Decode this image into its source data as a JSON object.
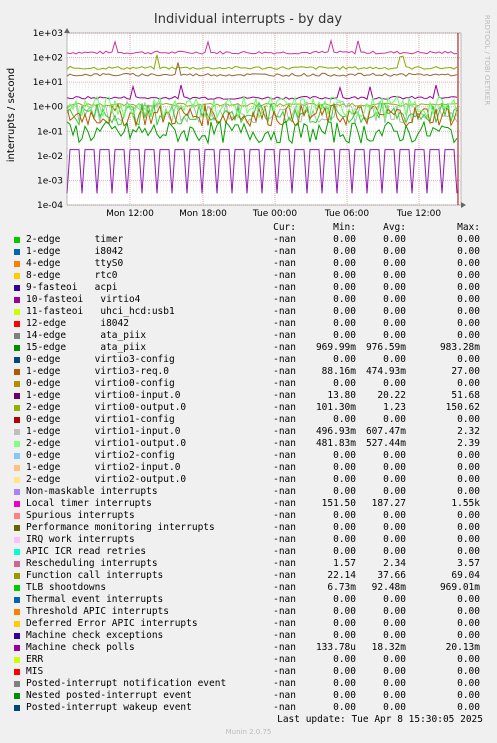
{
  "title": "Individual interrupts - by day",
  "ylabel": "interrupts / second",
  "side_label": "RRDTOOL / TOBI OETIKER",
  "columns": {
    "cur": "Cur:",
    "min": "Min:",
    "avg": "Avg:",
    "max": "Max:"
  },
  "colors": {
    "background": "#f0f0f0",
    "plot_bg": "#ffffff",
    "grid_major": "#e0b0b0",
    "grid_minor": "#ededed",
    "frame": "#808080",
    "now_marker": "#aa0000"
  },
  "chart_data": {
    "type": "line",
    "yscale": "log",
    "ylim": [
      0.0001,
      1000
    ],
    "yticks": [
      "1e-04",
      "1e-03",
      "1e-02",
      "1e-01",
      "1e+00",
      "1e+01",
      "1e+02",
      "1e+03"
    ],
    "xticks": [
      "Mon 12:00",
      "Mon 18:00",
      "Tue 00:00",
      "Tue 06:00",
      "Tue 12:00"
    ],
    "series": [
      {
        "name": "Local timer interrupts",
        "color": "#CC3399",
        "level": 160
      },
      {
        "name": "Rescheduling interrupts",
        "color": "#990099",
        "level": 2.3
      },
      {
        "name": "Function call interrupts",
        "color": "#88AA00",
        "level": 38
      },
      {
        "name": "virtio0-output.0",
        "color": "#8FAF1F",
        "level": 1.2
      },
      {
        "name": "virtio1-input.0",
        "color": "#A3C2A3",
        "level": 0.6
      },
      {
        "name": "virtio1-output.0",
        "color": "#33CC33",
        "level": 0.5
      },
      {
        "name": "virtio3-req.0",
        "color": "#B35A00",
        "level": 0.45
      },
      {
        "name": "ata_piix",
        "color": "#66FF66",
        "level": 0.97
      },
      {
        "name": "virtio0-input.0",
        "color": "#996633",
        "level": 20
      },
      {
        "name": "TLB shootdowns",
        "color": "#00A000",
        "level": 0.09
      },
      {
        "name": "Machine check polls",
        "color": "#8C1AB3",
        "level": 0.018
      }
    ]
  },
  "legend": [
    {
      "name": "2-edge      timer",
      "color": "#00CC00",
      "cur": "-nan",
      "min": "0.00",
      "avg": "0.00",
      "max": "0.00"
    },
    {
      "name": "1-edge      i8042",
      "color": "#0066B3",
      "cur": "-nan",
      "min": "0.00",
      "avg": "0.00",
      "max": "0.00"
    },
    {
      "name": "4-edge      ttyS0",
      "color": "#FF8000",
      "cur": "-nan",
      "min": "0.00",
      "avg": "0.00",
      "max": "0.00"
    },
    {
      "name": "8-edge      rtc0",
      "color": "#FFCC00",
      "cur": "-nan",
      "min": "0.00",
      "avg": "0.00",
      "max": "0.00"
    },
    {
      "name": "9-fasteoi   acpi",
      "color": "#330099",
      "cur": "-nan",
      "min": "0.00",
      "avg": "0.00",
      "max": "0.00"
    },
    {
      "name": "10-fasteoi   virtio4",
      "color": "#990099",
      "cur": "-nan",
      "min": "0.00",
      "avg": "0.00",
      "max": "0.00"
    },
    {
      "name": "11-fasteoi   uhci_hcd:usb1",
      "color": "#CCFF00",
      "cur": "-nan",
      "min": "0.00",
      "avg": "0.00",
      "max": "0.00"
    },
    {
      "name": "12-edge      i8042",
      "color": "#FF0000",
      "cur": "-nan",
      "min": "0.00",
      "avg": "0.00",
      "max": "0.00"
    },
    {
      "name": "14-edge      ata_piix",
      "color": "#808080",
      "cur": "-nan",
      "min": "0.00",
      "avg": "0.00",
      "max": "0.00"
    },
    {
      "name": "15-edge      ata_piix",
      "color": "#008F00",
      "cur": "-nan",
      "min": "969.99m",
      "avg": "976.59m",
      "max": "983.28m"
    },
    {
      "name": "0-edge      virtio3-config",
      "color": "#00487D",
      "cur": "-nan",
      "min": "0.00",
      "avg": "0.00",
      "max": "0.00"
    },
    {
      "name": "1-edge      virtio3-req.0",
      "color": "#B35A00",
      "cur": "-nan",
      "min": "88.16m",
      "avg": "474.93m",
      "max": "27.00"
    },
    {
      "name": "0-edge      virtio0-config",
      "color": "#B38F00",
      "cur": "-nan",
      "min": "0.00",
      "avg": "0.00",
      "max": "0.00"
    },
    {
      "name": "1-edge      virtio0-input.0",
      "color": "#6B006B",
      "cur": "-nan",
      "min": "13.80",
      "avg": "20.22",
      "max": "51.68"
    },
    {
      "name": "2-edge      virtio0-output.0",
      "color": "#8FB300",
      "cur": "-nan",
      "min": "101.30m",
      "avg": "1.23",
      "max": "150.62"
    },
    {
      "name": "0-edge      virtio1-config",
      "color": "#B30000",
      "cur": "-nan",
      "min": "0.00",
      "avg": "0.00",
      "max": "0.00"
    },
    {
      "name": "1-edge      virtio1-input.0",
      "color": "#BEBEBE",
      "cur": "-nan",
      "min": "496.93m",
      "avg": "607.47m",
      "max": "2.32"
    },
    {
      "name": "2-edge      virtio1-output.0",
      "color": "#80FF80",
      "cur": "-nan",
      "min": "481.83m",
      "avg": "527.44m",
      "max": "2.39"
    },
    {
      "name": "0-edge      virtio2-config",
      "color": "#80C9FF",
      "cur": "-nan",
      "min": "0.00",
      "avg": "0.00",
      "max": "0.00"
    },
    {
      "name": "1-edge      virtio2-input.0",
      "color": "#FFC080",
      "cur": "-nan",
      "min": "0.00",
      "avg": "0.00",
      "max": "0.00"
    },
    {
      "name": "2-edge      virtio2-output.0",
      "color": "#FFE680",
      "cur": "-nan",
      "min": "0.00",
      "avg": "0.00",
      "max": "0.00"
    },
    {
      "name": "Non-maskable interrupts",
      "color": "#AA80FF",
      "cur": "-nan",
      "min": "0.00",
      "avg": "0.00",
      "max": "0.00"
    },
    {
      "name": "Local timer interrupts",
      "color": "#EE00CC",
      "cur": "-nan",
      "min": "151.50",
      "avg": "187.27",
      "max": "1.55k"
    },
    {
      "name": "Spurious interrupts",
      "color": "#FF8080",
      "cur": "-nan",
      "min": "0.00",
      "avg": "0.00",
      "max": "0.00"
    },
    {
      "name": "Performance monitoring interrupts",
      "color": "#666600",
      "cur": "-nan",
      "min": "0.00",
      "avg": "0.00",
      "max": "0.00"
    },
    {
      "name": "IRQ work interrupts",
      "color": "#FFBFFF",
      "cur": "-nan",
      "min": "0.00",
      "avg": "0.00",
      "max": "0.00"
    },
    {
      "name": "APIC ICR read retries",
      "color": "#00FFCC",
      "cur": "-nan",
      "min": "0.00",
      "avg": "0.00",
      "max": "0.00"
    },
    {
      "name": "Rescheduling interrupts",
      "color": "#CC6699",
      "cur": "-nan",
      "min": "1.57",
      "avg": "2.34",
      "max": "3.57"
    },
    {
      "name": "Function call interrupts",
      "color": "#999900",
      "cur": "-nan",
      "min": "22.14",
      "avg": "37.66",
      "max": "69.04"
    },
    {
      "name": "TLB shootdowns",
      "color": "#00CC00",
      "cur": "-nan",
      "min": "6.73m",
      "avg": "92.48m",
      "max": "969.01m"
    },
    {
      "name": "Thermal event interrupts",
      "color": "#0066B3",
      "cur": "-nan",
      "min": "0.00",
      "avg": "0.00",
      "max": "0.00"
    },
    {
      "name": "Threshold APIC interrupts",
      "color": "#FF8000",
      "cur": "-nan",
      "min": "0.00",
      "avg": "0.00",
      "max": "0.00"
    },
    {
      "name": "Deferred Error APIC interrupts",
      "color": "#FFCC00",
      "cur": "-nan",
      "min": "0.00",
      "avg": "0.00",
      "max": "0.00"
    },
    {
      "name": "Machine check exceptions",
      "color": "#330099",
      "cur": "-nan",
      "min": "0.00",
      "avg": "0.00",
      "max": "0.00"
    },
    {
      "name": "Machine check polls",
      "color": "#990099",
      "cur": "-nan",
      "min": "133.78u",
      "avg": "18.32m",
      "max": "20.13m"
    },
    {
      "name": "ERR",
      "color": "#CCFF00",
      "cur": "-nan",
      "min": "0.00",
      "avg": "0.00",
      "max": "0.00"
    },
    {
      "name": "MIS",
      "color": "#FF0000",
      "cur": "-nan",
      "min": "0.00",
      "avg": "0.00",
      "max": "0.00"
    },
    {
      "name": "Posted-interrupt notification event",
      "color": "#808080",
      "cur": "-nan",
      "min": "0.00",
      "avg": "0.00",
      "max": "0.00"
    },
    {
      "name": "Nested posted-interrupt event",
      "color": "#008F00",
      "cur": "-nan",
      "min": "0.00",
      "avg": "0.00",
      "max": "0.00"
    },
    {
      "name": "Posted-interrupt wakeup event",
      "color": "#00487D",
      "cur": "-nan",
      "min": "0.00",
      "avg": "0.00",
      "max": "0.00"
    }
  ],
  "last_update": "Last update:  Tue Apr  8 15:30:05 2025",
  "footer": "Munin 2.0.75"
}
